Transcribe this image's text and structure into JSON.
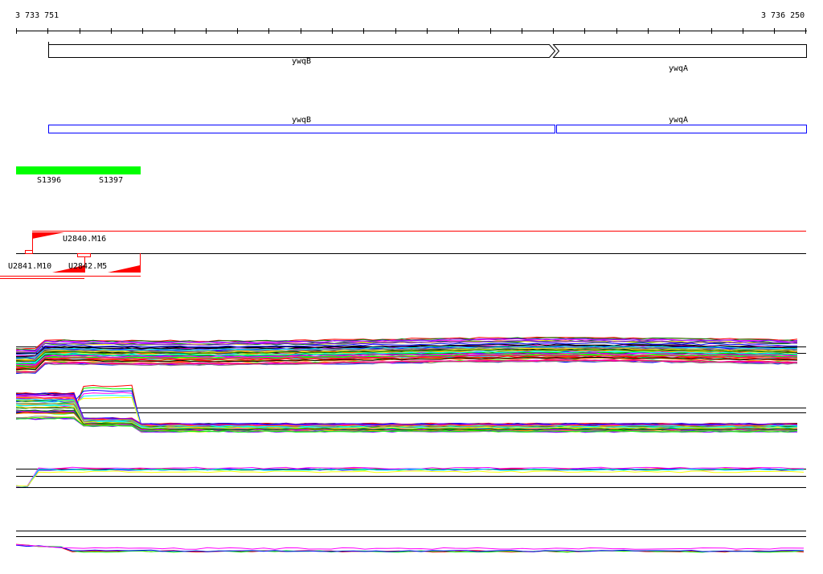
{
  "ruler": {
    "start_label": "3 733 751",
    "end_label": "3 736 250"
  },
  "genes": [
    {
      "name": "ywqB",
      "strand": "+"
    },
    {
      "name": "ywqA",
      "strand": "+"
    }
  ],
  "operons": [
    {
      "name": "ywqB"
    },
    {
      "name": "ywqA"
    }
  ],
  "terminators": [
    {
      "name": "S1396"
    },
    {
      "name": "S1397"
    }
  ],
  "upshifts": [
    {
      "name": "U2840.M16"
    },
    {
      "name": "U2841.M10"
    },
    {
      "name": "U2842.M5"
    }
  ],
  "colors": {
    "operon": "#0000ff",
    "terminator": "#00ff00",
    "upshift": "#ff0000"
  }
}
